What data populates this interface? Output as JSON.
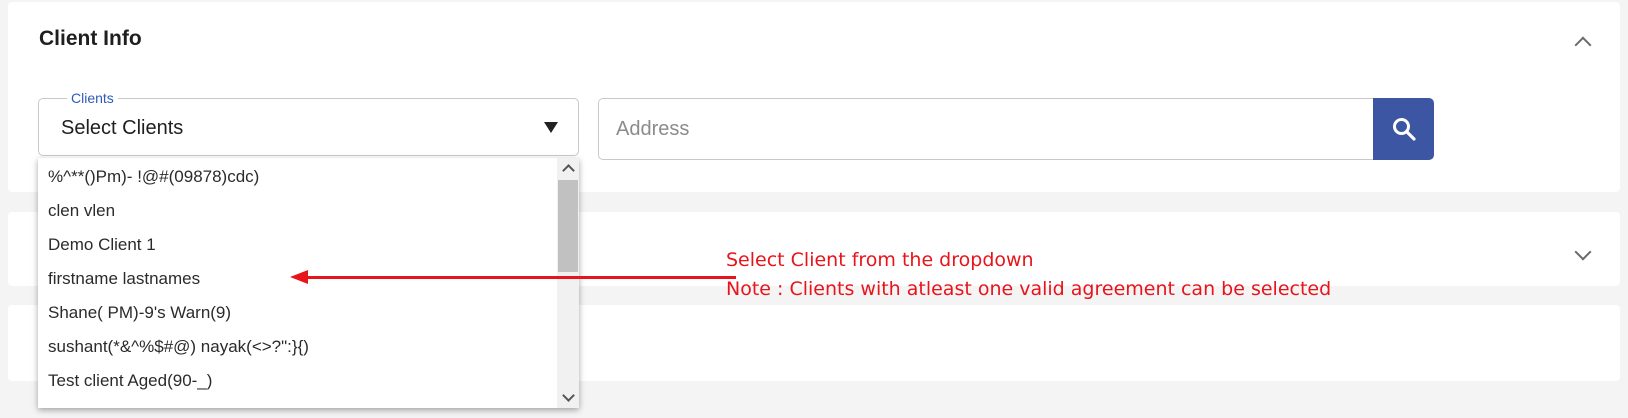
{
  "section": {
    "title": "Client Info",
    "collapse_icon": "chevron-up-icon",
    "second_section_icon": "chevron-down-icon"
  },
  "clients_select": {
    "legend": "Clients",
    "value": "Select Clients",
    "caret_icon": "caret-down-icon",
    "options": [
      "%^**()Pm)- !@#(09878)cdc)",
      "clen vlen",
      "Demo Client 1",
      "firstname lastnames",
      "Shane( PM)-9's Warn(9)",
      "sushant(*&^%$#@) nayak(<>?\":}{)",
      "Test client Aged(90-_)"
    ]
  },
  "address": {
    "placeholder": "Address",
    "value": "",
    "search_icon": "search-icon",
    "button_color": "#3d56a3"
  },
  "annotation": {
    "line1": "Select Client from the dropdown",
    "line2": "Note : Clients with atleast one valid agreement can be selected",
    "color": "#e8141b"
  }
}
